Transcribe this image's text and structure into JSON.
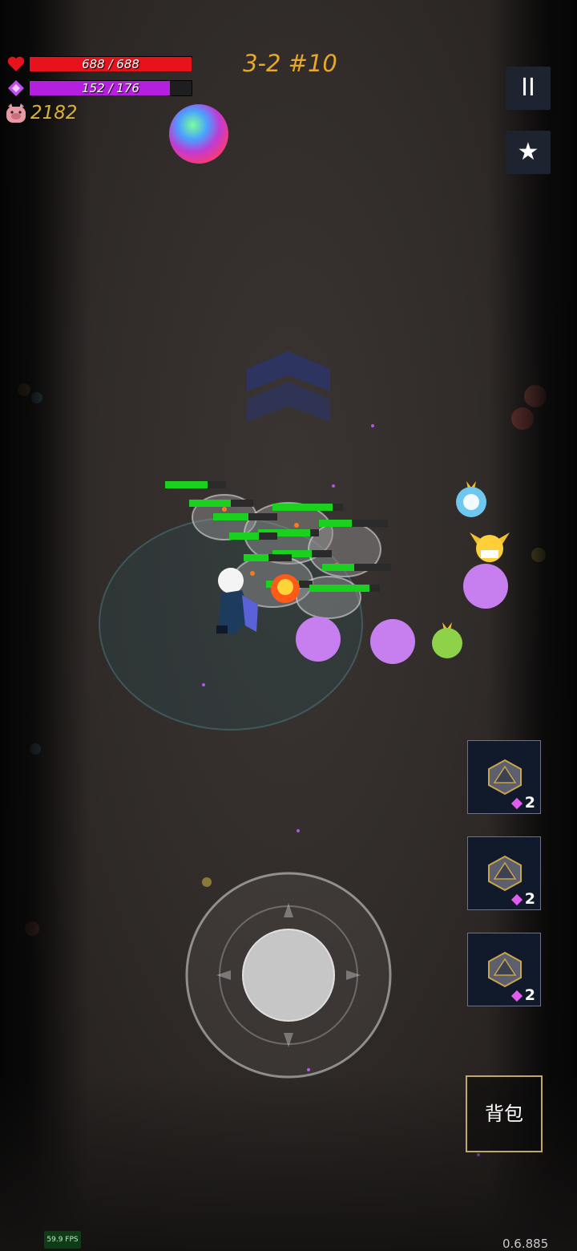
{
  "hud": {
    "hp_text": "688 / 688",
    "hp_fraction": 1.0,
    "mp_text": "152 / 176",
    "mp_fraction": 0.864,
    "coins": "2182",
    "level": "3-2 #10"
  },
  "buttons": {
    "pause_icon": "pause-icon",
    "favorite_icon": "star-icon",
    "bag_label": "背包"
  },
  "skills": [
    {
      "icon": "d20-dice-icon",
      "cost": "2"
    },
    {
      "icon": "d20-dice-icon",
      "cost": "2"
    },
    {
      "icon": "d20-dice-icon",
      "cost": "2"
    }
  ],
  "footer": {
    "fps": "59.9 FPS",
    "version": "0.6.885"
  },
  "colors": {
    "hp": "#e8121c",
    "mp": "#b41fe0",
    "level": "#e8a92a",
    "coins": "#d9b23a",
    "enemy_hp": "#19d11e"
  }
}
